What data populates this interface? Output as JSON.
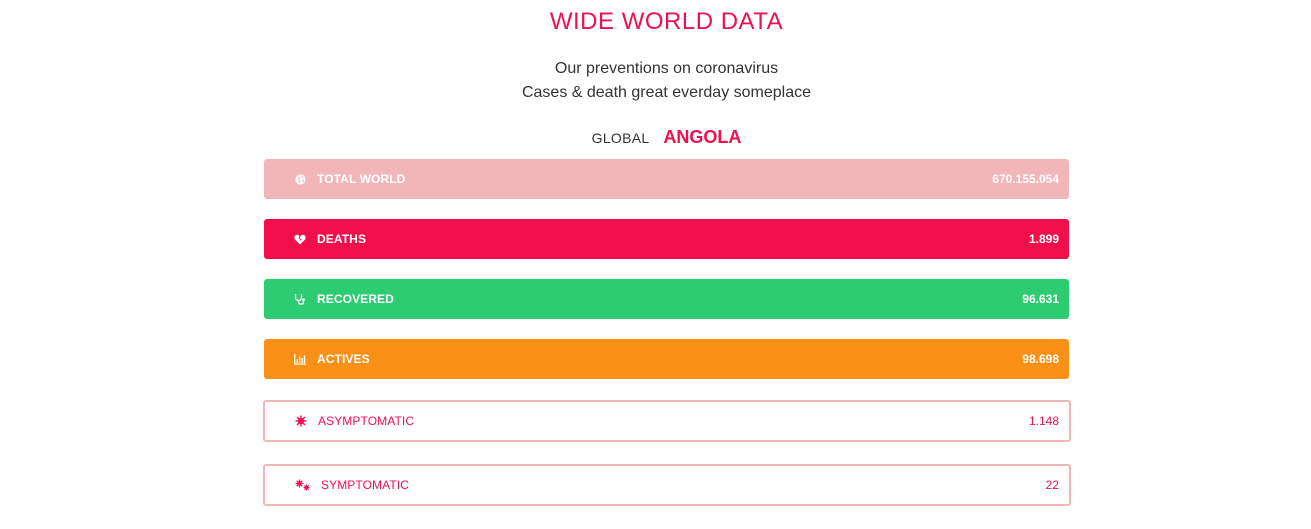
{
  "header": {
    "title": "WIDE WORLD DATA",
    "subtitle_line1": "Our preventions on coronavirus",
    "subtitle_line2": "Cases & death great everday someplace"
  },
  "tabs": {
    "global_label": "GLOBAL",
    "country_label": "ANGOLA"
  },
  "stats": {
    "total_world": {
      "label": "TOTAL WORLD",
      "value": "670.155.054",
      "color": "#f3b6b8",
      "icon": "globe-icon"
    },
    "deaths": {
      "label": "DEATHS",
      "value": "1.899",
      "color": "#f10f4b",
      "icon": "broken-heart-icon"
    },
    "recovered": {
      "label": "RECOVERED",
      "value": "96.631",
      "color": "#2ecc71",
      "icon": "stethoscope-icon"
    },
    "actives": {
      "label": "ACTIVES",
      "value": "98.698",
      "color": "#fb9017",
      "icon": "bar-chart-icon"
    },
    "asymptomatic": {
      "label": "ASYMPTOMATIC",
      "value": "1.148",
      "color": "#f01050",
      "icon": "virus-icon"
    },
    "symptomatic": {
      "label": "SYMPTOMATIC",
      "value": "22",
      "color": "#f01050",
      "icon": "viruses-icon"
    }
  }
}
